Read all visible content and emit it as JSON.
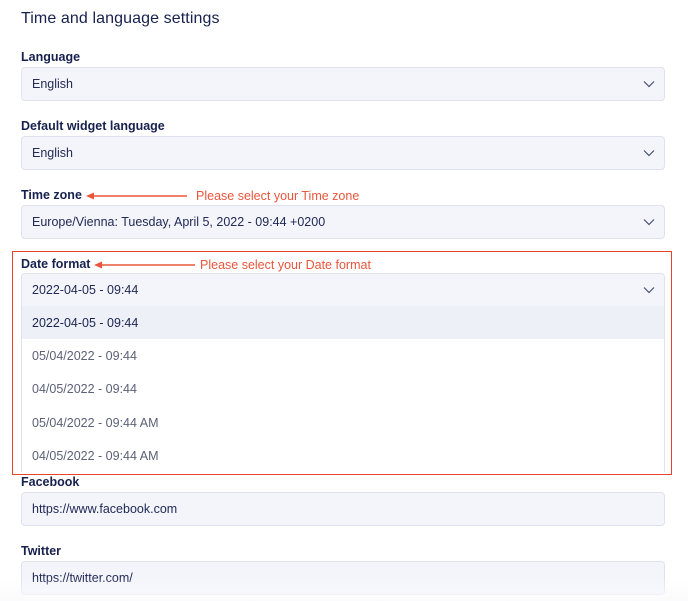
{
  "page_title": "Time and language settings",
  "language": {
    "label": "Language",
    "value": "English"
  },
  "widget_language": {
    "label": "Default widget language",
    "value": "English"
  },
  "time_zone": {
    "label": "Time zone",
    "value": "Europe/Vienna: Tuesday, April 5, 2022 - 09:44 +0200",
    "annotation": "Please select your Time zone"
  },
  "date_format": {
    "label": "Date format",
    "value": "2022-04-05 - 09:44",
    "annotation": "Please select your Date format",
    "options": [
      "2022-04-05 - 09:44",
      "05/04/2022 - 09:44",
      "04/05/2022 - 09:44",
      "05/04/2022 - 09:44 AM",
      "04/05/2022 - 09:44 AM"
    ]
  },
  "facebook": {
    "label": "Facebook",
    "value": "https://www.facebook.com"
  },
  "twitter": {
    "label": "Twitter",
    "value": "https://twitter.com/"
  },
  "colors": {
    "annotation": "#e8563c",
    "highlight_border": "#e5442a",
    "field_bg": "#f4f5fb"
  }
}
